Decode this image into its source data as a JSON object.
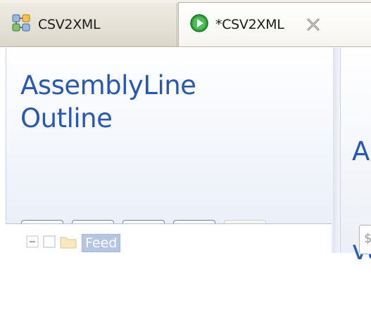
{
  "tabs": [
    {
      "label": "CSV2XML",
      "icon": "assemblyline-icon",
      "active": false
    },
    {
      "label": "*CSV2XML",
      "icon": "run-icon",
      "active": true,
      "close_icon": "close-icon"
    }
  ],
  "outline_panel": {
    "title_line1": "AssemblyLine",
    "title_line2": "Outline",
    "toolbar": [
      {
        "icon": "step-into-icon",
        "enabled": true
      },
      {
        "icon": "step-over-icon",
        "enabled": true
      },
      {
        "icon": "run-to-icon",
        "enabled": true
      },
      {
        "icon": "stop-icon",
        "enabled": true
      },
      {
        "icon": "breakpoints-icon",
        "enabled": false
      }
    ],
    "tree": {
      "node_label": "Feed"
    }
  },
  "right_panel": {
    "title_line1": "A",
    "title_line2": "va",
    "field_value": "$"
  },
  "colors": {
    "title": "#2659b6",
    "stop": "#e01919",
    "run": "#2fa33a"
  }
}
